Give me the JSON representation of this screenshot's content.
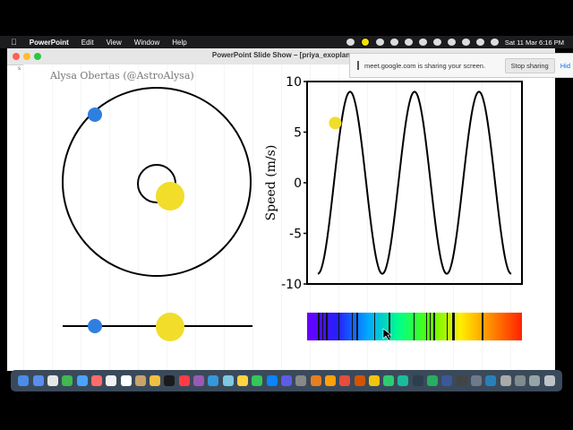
{
  "menubar": {
    "apple_icon": "apple-icon",
    "app_name": "PowerPoint",
    "menus": [
      "Edit",
      "View",
      "Window",
      "Help"
    ],
    "clock": "Sat 11 Mar  6:16 PM"
  },
  "window": {
    "title": "PowerPoint Slide Show – [priya_exoplan",
    "light_colors": [
      "#fe5f57",
      "#febc2e",
      "#28c840"
    ]
  },
  "meet_banner": {
    "message": "meet.google.com is sharing your screen.",
    "stop_label": "Stop sharing",
    "hide_label": "Hid"
  },
  "slide": {
    "credit": "Alysa Obertas (@AstroAlysa)",
    "edge_marker": "s",
    "colors": {
      "planet": "#2f7fe0",
      "star": "#f1dd2a",
      "orbit": "#000000"
    }
  },
  "chart_data": {
    "type": "line",
    "title": "",
    "xlabel": "",
    "ylabel": "Speed (m/s)",
    "ylim": [
      -10,
      10
    ],
    "yticks": [
      "10",
      "5",
      "0",
      "-5",
      "-10"
    ],
    "xticks": [],
    "series": [
      {
        "points": [
          [
            0,
            -9
          ],
          [
            0.5,
            9
          ],
          [
            1,
            -9
          ],
          [
            1.5,
            9
          ],
          [
            2,
            -9
          ],
          [
            2.5,
            9
          ],
          [
            3,
            -9
          ]
        ]
      }
    ],
    "marker": {
      "x": 0.27,
      "y": 5.9,
      "color": "#f1dd2a"
    }
  },
  "spectrum": {
    "gradient": [
      "#6a00ff",
      "#2222ff",
      "#00aaff",
      "#00ff88",
      "#55ff00",
      "#ffee00",
      "#ff8800",
      "#ff2200"
    ]
  },
  "dock": {
    "icon_colors": [
      "#4a8ce8",
      "#5b8def",
      "#e6e6e6",
      "#3fb950",
      "#4aa3ff",
      "#ff6b6b",
      "#f2f2f2",
      "#ffffff",
      "#c9a36b",
      "#f0c040",
      "#1a1a1a",
      "#fc3c44",
      "#9b59b6",
      "#3498db",
      "#7ec8e3",
      "#ffd23f",
      "#34c759",
      "#0a84ff",
      "#5e5ce6",
      "#888888",
      "#e67e22",
      "#ff9f0a",
      "#e74c3c",
      "#d35400",
      "#f1c40f",
      "#2ecc71",
      "#1abc9c",
      "#2c3e50",
      "#27ae60",
      "#3b5998",
      "#444444",
      "#6c7a89",
      "#2980b9",
      "#aaaaaa",
      "#7f8c8d",
      "#95a5a6",
      "#bdc3c7"
    ]
  }
}
